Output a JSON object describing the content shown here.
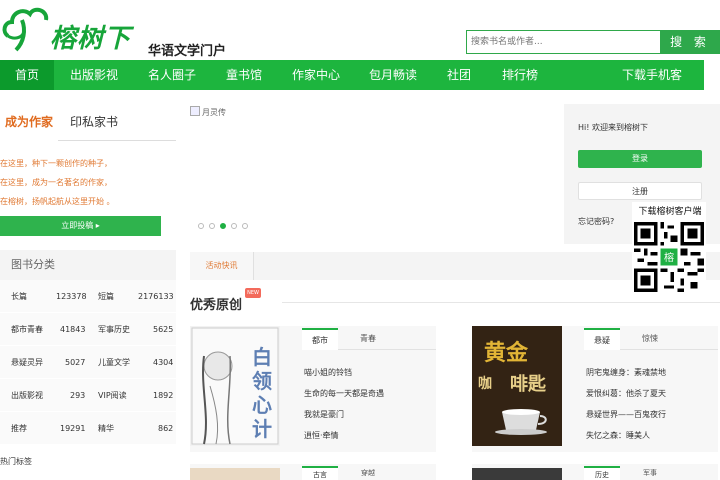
{
  "brand": {
    "logo_text": "榕树下",
    "tagline": "华语文学门户",
    "accent": "#1db53e"
  },
  "search": {
    "placeholder": "搜索书名或作者...",
    "button": "搜 索"
  },
  "nav": {
    "items": [
      "首页",
      "出版影视",
      "名人圈子",
      "童书馆",
      "作家中心",
      "包月畅读",
      "社团",
      "排行榜",
      "下载手机客户端"
    ]
  },
  "left": {
    "tab_active": "成为作家",
    "tab_other": "印私家书",
    "intro": [
      "在这里，种下一颗创作的种子，",
      "在这里，成为一名著名的作家，",
      "在榕树，扬帆起航从这里开始 。"
    ],
    "submit_button": "立即投稿 ▸",
    "categories_title": "图书分类",
    "categories": [
      {
        "name": "长篇",
        "count": "123378",
        "name2": "短篇",
        "count2": "2176133"
      },
      {
        "name": "都市青春",
        "count": "41843",
        "name2": "军事历史",
        "count2": "5625"
      },
      {
        "name": "悬疑灵异",
        "count": "5027",
        "name2": "儿童文学",
        "count2": "4304"
      },
      {
        "name": "出版影视",
        "count": "293",
        "name2": "VIP阅读",
        "count2": "1892"
      },
      {
        "name": "推荐",
        "count": "19291",
        "name2": "精华",
        "count2": "862"
      }
    ],
    "hot_tags": "热门标签"
  },
  "slide": {
    "image_alt": "月灵传",
    "dot_count": 5,
    "active_dot": 3
  },
  "activity": {
    "tab": "活动快讯"
  },
  "original": {
    "title": "优秀原创",
    "badge": "NEW",
    "cards": [
      {
        "cover_title": "白领心计",
        "tab_active": "都市",
        "tab_other": "青春",
        "items": [
          "喵小姐的铃铛",
          "生命的每一天都是奇遇",
          "我就是豪门",
          "逍恒·牵情"
        ]
      },
      {
        "cover_title": "黄金咖啡匙",
        "tab_active": "悬疑",
        "tab_other": "惊悚",
        "items": [
          "阴宅鬼缠身：素魂禁地",
          "爱恨纠葛：他杀了夏天",
          "悬疑世界——百鬼夜行",
          "失忆之森：睡美人"
        ]
      }
    ],
    "cards_row2": [
      {
        "tab_active": "古言",
        "tab_other": "穿越"
      },
      {
        "tab_active": "历史",
        "tab_other": "军事"
      }
    ]
  },
  "login": {
    "welcome": "Hi! 欢迎来到榕树下",
    "login_button": "登录",
    "register_button": "注册",
    "forgot": "忘记密码?"
  },
  "qr": {
    "label": "下载榕树客户端"
  }
}
